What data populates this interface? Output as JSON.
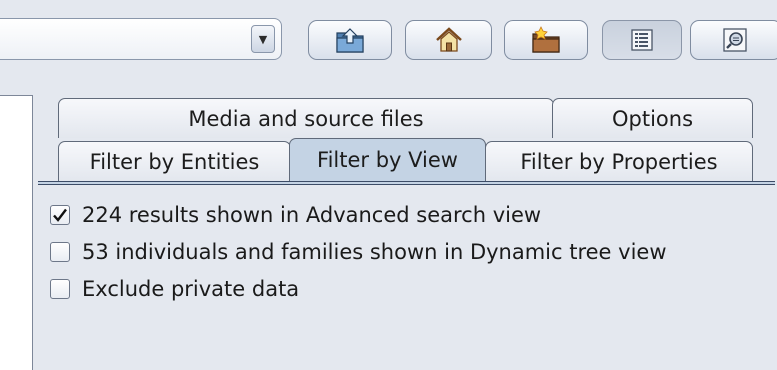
{
  "toolbar": {
    "combo_value": "",
    "buttons": [
      {
        "name": "folder-up-icon"
      },
      {
        "name": "home-icon"
      },
      {
        "name": "folder-star-icon"
      },
      {
        "name": "list-view-icon",
        "pressed": true
      },
      {
        "name": "search-view-icon"
      }
    ]
  },
  "tabs": {
    "row1": [
      {
        "label": "Media and source files"
      },
      {
        "label": "Options"
      }
    ],
    "row2": [
      {
        "label": "Filter by Entities"
      },
      {
        "label": "Filter by View",
        "selected": true
      },
      {
        "label": "Filter by Properties"
      }
    ]
  },
  "options": [
    {
      "label": "224 results shown in Advanced search view",
      "checked": true
    },
    {
      "label": "53 individuals and families shown in Dynamic tree view",
      "checked": false
    },
    {
      "label": "Exclude private data",
      "checked": false
    }
  ],
  "colors": {
    "background": "#e4e8ef",
    "selected_tab": "#c4d3e4",
    "border_dark": "#3c4c67"
  }
}
